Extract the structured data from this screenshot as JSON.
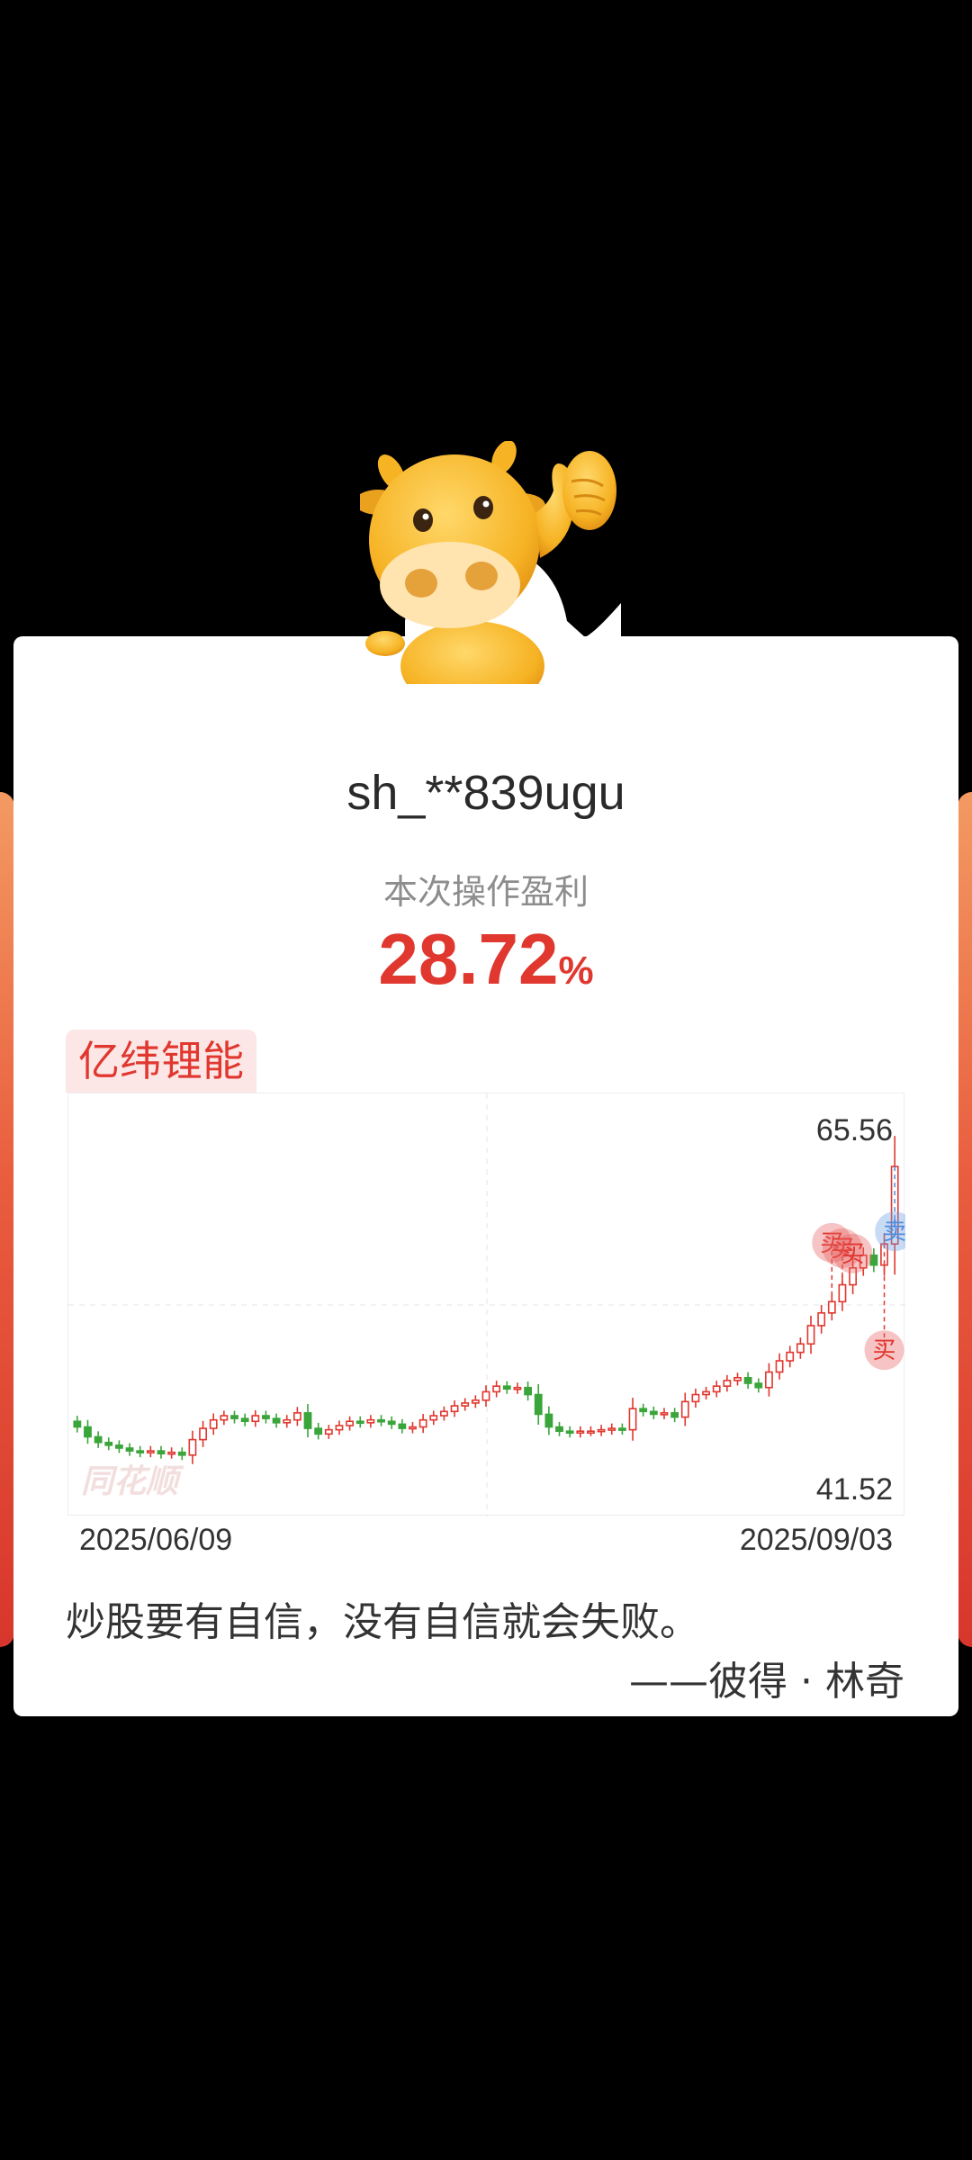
{
  "share_card": {
    "username": "sh_**839ugu",
    "profit_label": "本次操作盈利",
    "profit_value": "28.72",
    "profit_unit": "%",
    "stock_name": "亿纬锂能",
    "watermark": "同花顺",
    "quote": "炒股要有自信，没有自信就会失败。",
    "quote_author": "——彼得 · 林奇"
  },
  "chart_data": {
    "type": "candlestick",
    "x_start_label": "2025/06/09",
    "x_end_label": "2025/09/03",
    "ylim": [
      41.52,
      65.56
    ],
    "y_max_label": "65.56",
    "y_min_label": "41.52",
    "grid": true,
    "colors": {
      "up": "#e0372f",
      "down": "#3aa53a",
      "buy": "#e0372f",
      "sell": "#4a8ee0"
    },
    "closes": [
      44.3,
      43.6,
      43.2,
      43.0,
      42.8,
      42.6,
      42.5,
      42.6,
      42.4,
      42.5,
      42.3,
      43.4,
      44.2,
      44.8,
      45.1,
      44.9,
      44.7,
      45.1,
      44.9,
      44.6,
      44.8,
      45.3,
      44.2,
      43.8,
      44.1,
      44.4,
      44.7,
      44.6,
      44.8,
      44.7,
      44.5,
      44.2,
      44.3,
      44.8,
      45.1,
      45.4,
      45.8,
      46.0,
      46.2,
      46.8,
      47.2,
      47.0,
      47.1,
      46.6,
      45.2,
      44.3,
      44.0,
      43.9,
      44.0,
      44.0,
      44.1,
      44.2,
      44.1,
      45.6,
      45.4,
      45.2,
      45.3,
      45.0,
      46.1,
      46.6,
      46.8,
      47.2,
      47.6,
      47.8,
      47.4,
      47.1,
      48.2,
      49.0,
      49.6,
      50.2,
      51.5,
      52.4,
      53.2,
      54.4,
      55.6,
      56.5,
      55.8,
      57.3,
      62.8
    ],
    "signals": [
      {
        "type": "buy",
        "label": "买",
        "index": 72
      },
      {
        "type": "buy",
        "label": "买",
        "index": 73
      },
      {
        "type": "buy",
        "label": "买",
        "index": 74
      },
      {
        "type": "buy",
        "label": "买",
        "index": 77
      },
      {
        "type": "sell",
        "label": "卖",
        "index": 78
      }
    ]
  }
}
